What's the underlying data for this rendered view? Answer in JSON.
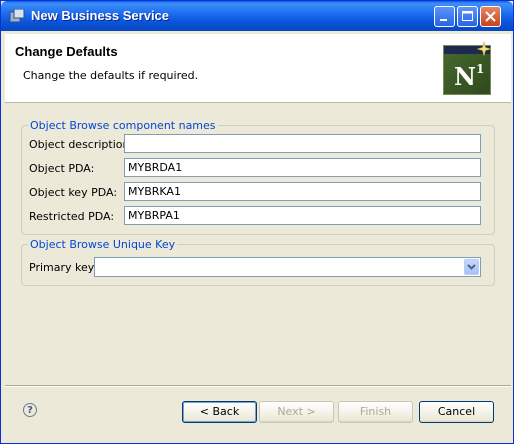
{
  "window": {
    "title": "New Business Service"
  },
  "header": {
    "title": "Change Defaults",
    "subtitle": "Change the defaults if required.",
    "logo_text": "N",
    "logo_sup": "1"
  },
  "group1": {
    "legend": "Object Browse component names",
    "fields": [
      {
        "label": "Object description:",
        "value": ""
      },
      {
        "label": "Object PDA:",
        "value": "MYBRDA1"
      },
      {
        "label": "Object key PDA:",
        "value": "MYBRKA1"
      },
      {
        "label": "Restricted PDA:",
        "value": "MYBRPA1"
      }
    ]
  },
  "group2": {
    "legend": "Object Browse Unique Key",
    "primary_key_label": "Primary key:",
    "primary_key_value": ""
  },
  "buttons": {
    "back": "< Back",
    "next": "Next >",
    "finish": "Finish",
    "cancel": "Cancel",
    "help": "?"
  }
}
